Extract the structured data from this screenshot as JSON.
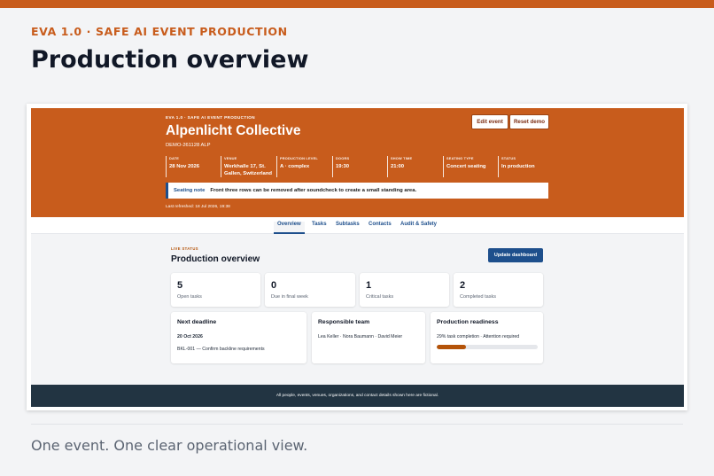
{
  "page": {
    "kicker": "EVA 1.0 · SAFE AI EVENT PRODUCTION",
    "title": "Production overview",
    "caption": "One event. One clear operational view."
  },
  "app": {
    "hero": {
      "kicker": "EVA 1.0 · SAFE AI EVENT PRODUCTION",
      "event_name": "Alpenlicht Collective",
      "event_id": "DEMO-261128 ALP",
      "edit_label": "Edit event",
      "reset_label": "Reset demo",
      "meta": [
        {
          "label": "DATE",
          "value": "28 Nov 2026"
        },
        {
          "label": "VENUE",
          "value": "Werkhalle 17, St. Gallen, Switzerland"
        },
        {
          "label": "PRODUCTION LEVEL",
          "value": "A · complex"
        },
        {
          "label": "DOORS",
          "value": "19:30"
        },
        {
          "label": "SHOW TIME",
          "value": "21:00"
        },
        {
          "label": "SEATING TYPE",
          "value": "Concert seating"
        },
        {
          "label": "STATUS",
          "value": "In production"
        }
      ],
      "note_label": "Seating note",
      "note_text": "Front three rows can be removed after soundcheck to create a small standing area.",
      "refreshed": "Last refreshed: 18 Jul 2026, 19:38"
    },
    "tabs": [
      {
        "label": "Overview",
        "active": true
      },
      {
        "label": "Tasks",
        "active": false
      },
      {
        "label": "Subtasks",
        "active": false
      },
      {
        "label": "Contacts",
        "active": false
      },
      {
        "label": "Audit & Safety",
        "active": false
      }
    ],
    "overview": {
      "live_label": "LIVE STATUS",
      "title": "Production overview",
      "update_label": "Update dashboard",
      "stats": [
        {
          "value": "5",
          "label": "Open tasks"
        },
        {
          "value": "0",
          "label": "Due in final week"
        },
        {
          "value": "1",
          "label": "Critical tasks"
        },
        {
          "value": "2",
          "label": "Completed tasks"
        }
      ],
      "deadline": {
        "title": "Next deadline",
        "date": "20 Oct 2026",
        "task": "BKL-001 — Confirm backline requirements"
      },
      "team": {
        "title": "Responsible team",
        "members": "Lea Keller · Nora Baumann · David Meier"
      },
      "readiness": {
        "title": "Production readiness",
        "summary": "29% task completion · Attention required",
        "progress": 0.29
      }
    },
    "footer": "All people, events, venues, organizations, and contact details shown here are fictional."
  },
  "colors": {
    "brand": "#c85c1c",
    "primary": "#1e4f8c",
    "accent_text": "#b45309",
    "footer_bg": "#223442"
  }
}
